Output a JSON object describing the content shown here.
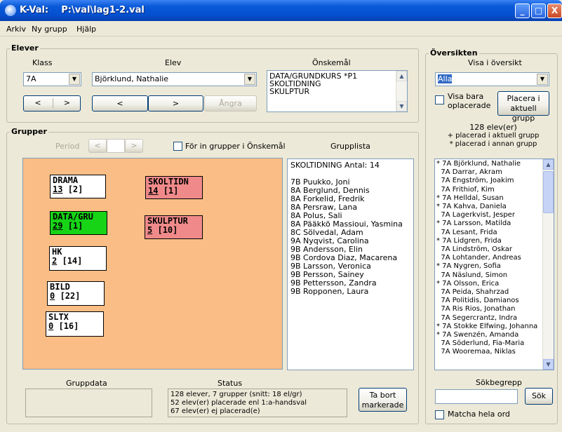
{
  "window": {
    "title": "K-Val:    P:\\val\\lag1-2.val",
    "min": "_",
    "max": "□",
    "close": "X"
  },
  "menu": [
    "Arkiv",
    "Ny grupp",
    "Hjälp"
  ],
  "elever": {
    "title": "Elever",
    "klass_label": "Klass",
    "elev_label": "Elev",
    "onskemal_label": "Önskemål",
    "klass_value": "7A",
    "elev_value": "Björklund, Nathalie",
    "onskemal": [
      "DATA/GRUNDKURS  *P1",
      "SKOLTIDNING",
      "SKULPTUR"
    ],
    "prev": "<",
    "next": ">",
    "angra": "Ångra"
  },
  "grupper": {
    "title": "Grupper",
    "period_label": "Period",
    "prev": "<",
    "next": ">",
    "for_in_label": "För in grupper i Önskemål",
    "grupplista_label": "Grupplista",
    "boxes": [
      {
        "name": "DRAMA",
        "count": "13",
        "extra": "[2]",
        "color": "#ffffff"
      },
      {
        "name": "SKOLTIDN",
        "count": "14",
        "extra": "[1]",
        "color": "#f08a8a"
      },
      {
        "name": "DATA/GRU",
        "count": "29",
        "extra": "[1]",
        "color": "#17d417"
      },
      {
        "name": "SKULPTUR",
        "count": "5",
        "extra": "[10]",
        "color": "#f08a8a"
      },
      {
        "name": "HK",
        "count": "2",
        "extra": "[14]",
        "color": "#ffffff"
      },
      {
        "name": "BILD",
        "count": "0",
        "extra": "[22]",
        "color": "#ffffff"
      },
      {
        "name": "SLTX",
        "count": "0",
        "extra": "[16]",
        "color": "#ffffff"
      }
    ],
    "grupplista_header": "SKOLTIDNING  Antal:  14",
    "grupplista": [
      "7B Puukko, Joni",
      "8A Berglund, Dennis",
      "8A Forkelid, Fredrik",
      "8A Persraw, Lana",
      "8A Polus, Sali",
      "8A Pääkkö Massioui, Yasmina",
      "8C Sölvedal, Adam",
      "9A Nyqvist, Carolina",
      "9B Andersson, Elin",
      "9B Cordova Diaz, Macarena",
      "9B Larsson, Veronica",
      "9B Persson, Sainey",
      "9B Pettersson, Zandra",
      "9B Ropponen, Laura"
    ]
  },
  "gruppdata_label": "Gruppdata",
  "status": {
    "label": "Status",
    "lines": [
      "128 elever, 7 grupper  (snitt: 18 el/gr)",
      "52 elev(er) placerade enl 1:a-handsval",
      "67 elev(er) ej placerad(e)"
    ]
  },
  "ta_bort": [
    "Ta bort",
    "markerade"
  ],
  "oversikten": {
    "title": "Översikten",
    "visa_label": "Visa i översikt",
    "visa_value": "Alla",
    "visa_bara": [
      "Visa bara",
      "oplacerade"
    ],
    "placera": [
      "Placera i",
      "aktuell grupp"
    ],
    "summary": [
      "128 elev(er)",
      "+ placerad i aktuell grupp",
      "* placerad i annan grupp"
    ],
    "students": [
      "* 7A Björklund, Nathalie",
      "  7A Darrar, Akram",
      "  7A Engström, Joakim",
      "  7A Frithiof, Kim",
      "* 7A Helldal, Susan",
      "* 7A Kahva, Daniela",
      "  7A Lagerkvist, Jesper",
      "* 7A Larsson, Matilda",
      "  7A Lesant, Frida",
      "* 7A Lidgren, Frida",
      "  7A Lindström, Oskar",
      "  7A Lohtander, Andreas",
      "* 7A Nygren, Sofia",
      "  7A Näslund, Simon",
      "* 7A Olsson, Erica",
      "  7A Peida, Shahrzad",
      "  7A Politidis, Damianos",
      "  7A Ris Rios, Jonathan",
      "  7A Segercrantz, Indra",
      "* 7A Stokke Elfwing, Johanna",
      "* 7A Swenzén, Amanda",
      "  7A Söderlund, Fia-Maria",
      "  7A Wooremaa, Niklas"
    ],
    "sok_label": "Sökbegrepp",
    "sok_button": "Sök",
    "matcha": "Matcha hela ord"
  }
}
